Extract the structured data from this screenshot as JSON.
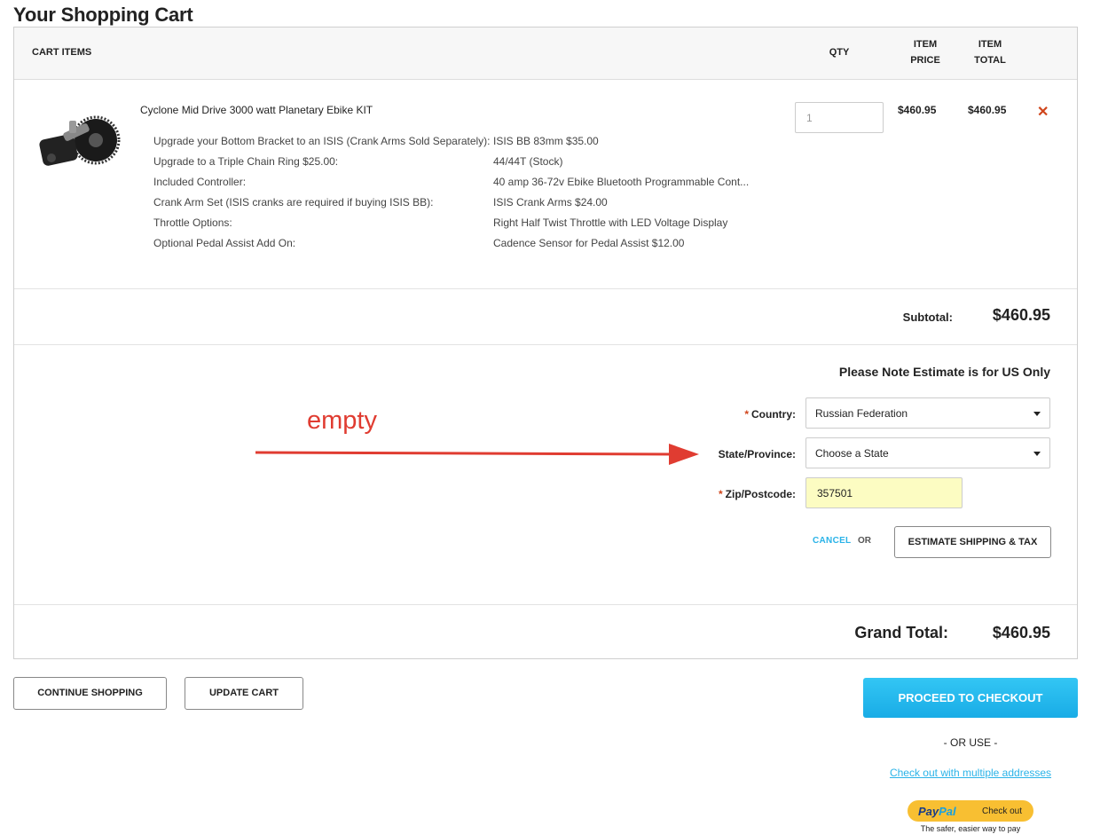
{
  "page": {
    "title": "Your Shopping Cart"
  },
  "cart": {
    "headers": {
      "items": "CART ITEMS",
      "qty": "QTY",
      "item_price_line1": "ITEM",
      "item_price_line2": "PRICE",
      "item_total_line1": "ITEM",
      "item_total_line2": "TOTAL"
    },
    "item": {
      "name": "Cyclone Mid Drive 3000 watt Planetary Ebike KIT",
      "qty": "1",
      "price": "$460.95",
      "total": "$460.95",
      "remove_icon": "close-icon",
      "options": [
        {
          "label": "Upgrade your Bottom Bracket to an ISIS (Crank Arms Sold Separately):",
          "value": "ISIS BB 83mm $35.00"
        },
        {
          "label": "Upgrade to a Triple Chain Ring $25.00:",
          "value": "44/44T (Stock)"
        },
        {
          "label": "Included Controller:",
          "value": "40 amp 36-72v Ebike Bluetooth Programmable Cont..."
        },
        {
          "label": "Crank Arm Set (ISIS cranks are required if buying ISIS BB):",
          "value": "ISIS Crank Arms $24.00"
        },
        {
          "label": "Throttle Options:",
          "value": "Right Half Twist Throttle with LED Voltage Display"
        },
        {
          "label": "Optional Pedal Assist Add On:",
          "value": "Cadence Sensor for Pedal Assist $12.00"
        }
      ]
    },
    "subtotal_label": "Subtotal:",
    "subtotal_value": "$460.95",
    "grand_total_label": "Grand Total:",
    "grand_total_value": "$460.95"
  },
  "estimate": {
    "note": "Please Note Estimate is for US Only",
    "required_mark": "*",
    "country_label": "Country:",
    "country_value": "Russian Federation",
    "state_label": "State/Province:",
    "state_value": "Choose a State",
    "zip_label": "Zip/Postcode:",
    "zip_value": "357501",
    "cancel": "CANCEL",
    "or": "OR",
    "estimate_button": "ESTIMATE SHIPPING & TAX"
  },
  "annotation": {
    "text": "empty",
    "color": "#e03c31"
  },
  "actions": {
    "continue_shopping": "CONTINUE SHOPPING",
    "update_cart": "UPDATE CART",
    "proceed_checkout": "PROCEED TO CHECKOUT",
    "or_use": "- OR USE -",
    "multiple_addresses": "Check out with multiple addresses"
  },
  "paypal": {
    "logo_pay": "Pay",
    "logo_pal": "Pal",
    "check_out": "Check out",
    "tagline": "The safer, easier way to pay"
  },
  "colors": {
    "accent": "#2ab3e8",
    "remove": "#d0451b",
    "zip_highlight": "#fcfcc2",
    "paypal_yellow": "#f8bf32"
  }
}
